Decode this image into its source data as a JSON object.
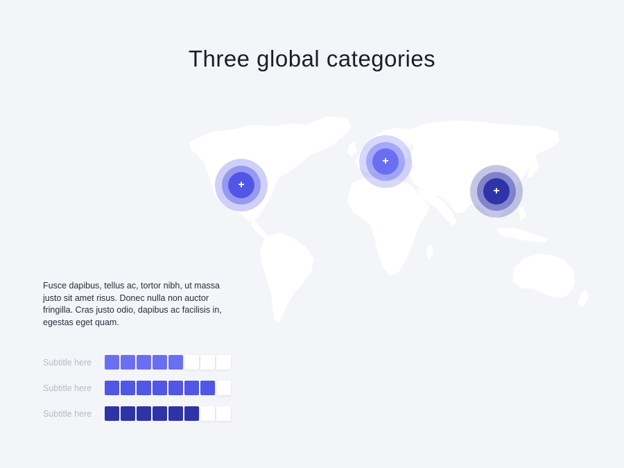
{
  "title": "Three global categories",
  "markers": [
    {
      "name": "north-america",
      "color": "#5156e6",
      "symbol": "+"
    },
    {
      "name": "europe",
      "color": "#6a6ff2",
      "symbol": "+"
    },
    {
      "name": "asia",
      "color": "#2f33a8",
      "symbol": "+"
    }
  ],
  "description": "Fusce dapibus, tellus ac, tortor nibh, ut massa justo sit amet risus. Donec nulla non auctor fringilla. Cras justo odio, dapibus ac facilisis in, egestas eget quam.",
  "rows": [
    {
      "label": "Subtitle here",
      "filled": 5,
      "total": 8,
      "color": "#6a6ff2"
    },
    {
      "label": "Subtitle here",
      "filled": 7,
      "total": 8,
      "color": "#5156e6"
    },
    {
      "label": "Subtitle here",
      "filled": 6,
      "total": 8,
      "color": "#2f33a8"
    }
  ]
}
